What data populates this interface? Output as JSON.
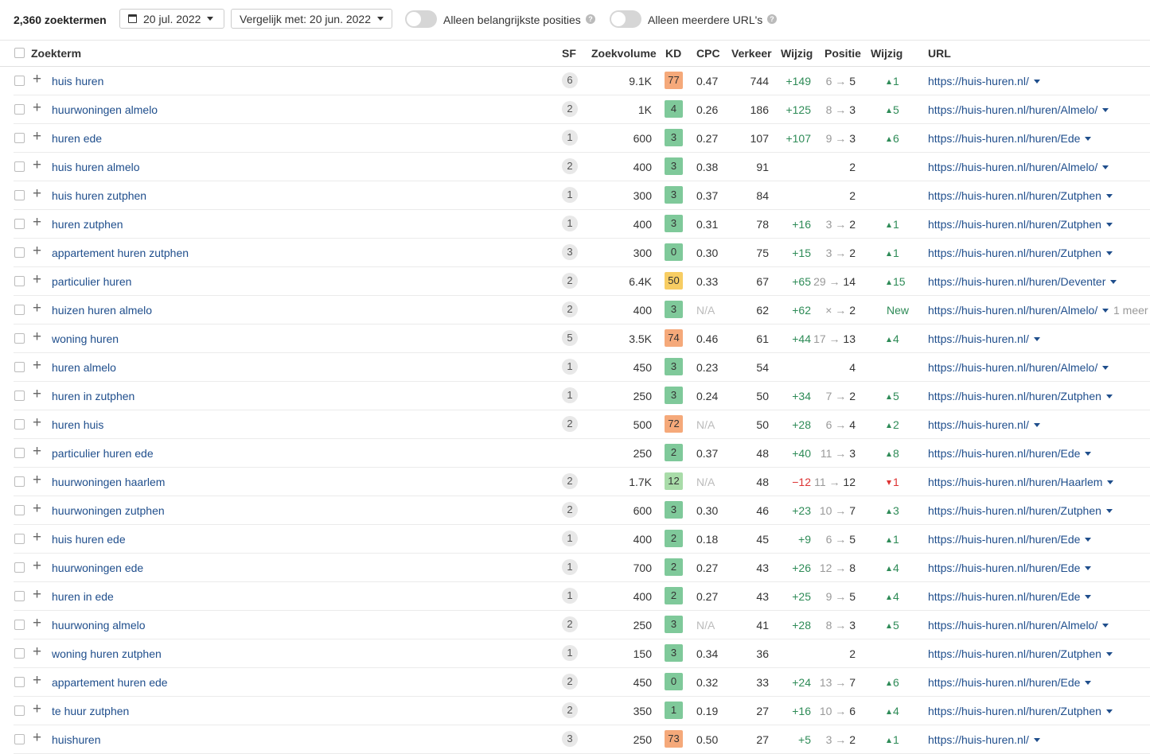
{
  "toolbar": {
    "count": "2,360 zoektermen",
    "date": "20 jul. 2022",
    "compare": "Vergelijk met: 20 jun. 2022",
    "toggle1": "Alleen belangrijkste posities",
    "toggle2": "Alleen meerdere URL's",
    "help": "?"
  },
  "headers": {
    "keyword": "Zoekterm",
    "sf": "SF",
    "volume": "Zoekvolume",
    "kd": "KD",
    "cpc": "CPC",
    "traffic": "Verkeer",
    "change": "Wijzig",
    "position": "Positie",
    "pos_change": "Wijzig",
    "url": "URL"
  },
  "colors": {
    "kd_green": "#7fc99a",
    "kd_lightgreen": "#a9dca9",
    "kd_yellow": "#f7cd63",
    "kd_orange": "#f5a97a",
    "link": "#1f4e8c",
    "up": "#2e8b57",
    "down": "#d33"
  },
  "rows": [
    {
      "kw": "huis huren",
      "sf": "6",
      "vol": "9.1K",
      "kd": "77",
      "cpc": "0.47",
      "traffic": "744",
      "chg": "+149",
      "from": "6",
      "to": "5",
      "pch": "1",
      "pdir": "up",
      "url": "https://huis-huren.nl/",
      "more": ""
    },
    {
      "kw": "huurwoningen almelo",
      "sf": "2",
      "vol": "1K",
      "kd": "4",
      "cpc": "0.26",
      "traffic": "186",
      "chg": "+125",
      "from": "8",
      "to": "3",
      "pch": "5",
      "pdir": "up",
      "url": "https://huis-huren.nl/huren/Almelo/",
      "more": ""
    },
    {
      "kw": "huren ede",
      "sf": "1",
      "vol": "600",
      "kd": "3",
      "cpc": "0.27",
      "traffic": "107",
      "chg": "+107",
      "from": "9",
      "to": "3",
      "pch": "6",
      "pdir": "up",
      "url": "https://huis-huren.nl/huren/Ede",
      "more": ""
    },
    {
      "kw": "huis huren almelo",
      "sf": "2",
      "vol": "400",
      "kd": "3",
      "cpc": "0.38",
      "traffic": "91",
      "chg": "",
      "from": "",
      "to": "2",
      "pch": "",
      "pdir": "",
      "url": "https://huis-huren.nl/huren/Almelo/",
      "more": ""
    },
    {
      "kw": "huis huren zutphen",
      "sf": "1",
      "vol": "300",
      "kd": "3",
      "cpc": "0.37",
      "traffic": "84",
      "chg": "",
      "from": "",
      "to": "2",
      "pch": "",
      "pdir": "",
      "url": "https://huis-huren.nl/huren/Zutphen",
      "more": ""
    },
    {
      "kw": "huren zutphen",
      "sf": "1",
      "vol": "400",
      "kd": "3",
      "cpc": "0.31",
      "traffic": "78",
      "chg": "+16",
      "from": "3",
      "to": "2",
      "pch": "1",
      "pdir": "up",
      "url": "https://huis-huren.nl/huren/Zutphen",
      "more": ""
    },
    {
      "kw": "appartement huren zutphen",
      "sf": "3",
      "vol": "300",
      "kd": "0",
      "cpc": "0.30",
      "traffic": "75",
      "chg": "+15",
      "from": "3",
      "to": "2",
      "pch": "1",
      "pdir": "up",
      "url": "https://huis-huren.nl/huren/Zutphen",
      "more": ""
    },
    {
      "kw": "particulier huren",
      "sf": "2",
      "vol": "6.4K",
      "kd": "50",
      "cpc": "0.33",
      "traffic": "67",
      "chg": "+65",
      "from": "29",
      "to": "14",
      "pch": "15",
      "pdir": "up",
      "url": "https://huis-huren.nl/huren/Deventer",
      "more": ""
    },
    {
      "kw": "huizen huren almelo",
      "sf": "2",
      "vol": "400",
      "kd": "3",
      "cpc": "N/A",
      "traffic": "62",
      "chg": "+62",
      "from": "×",
      "to": "2",
      "pch": "New",
      "pdir": "new",
      "url": "https://huis-huren.nl/huren/Almelo/",
      "more": "1 meer"
    },
    {
      "kw": "woning huren",
      "sf": "5",
      "vol": "3.5K",
      "kd": "74",
      "cpc": "0.46",
      "traffic": "61",
      "chg": "+44",
      "from": "17",
      "to": "13",
      "pch": "4",
      "pdir": "up",
      "url": "https://huis-huren.nl/",
      "more": ""
    },
    {
      "kw": "huren almelo",
      "sf": "1",
      "vol": "450",
      "kd": "3",
      "cpc": "0.23",
      "traffic": "54",
      "chg": "",
      "from": "",
      "to": "4",
      "pch": "",
      "pdir": "",
      "url": "https://huis-huren.nl/huren/Almelo/",
      "more": ""
    },
    {
      "kw": "huren in zutphen",
      "sf": "1",
      "vol": "250",
      "kd": "3",
      "cpc": "0.24",
      "traffic": "50",
      "chg": "+34",
      "from": "7",
      "to": "2",
      "pch": "5",
      "pdir": "up",
      "url": "https://huis-huren.nl/huren/Zutphen",
      "more": ""
    },
    {
      "kw": "huren huis",
      "sf": "2",
      "vol": "500",
      "kd": "72",
      "cpc": "N/A",
      "traffic": "50",
      "chg": "+28",
      "from": "6",
      "to": "4",
      "pch": "2",
      "pdir": "up",
      "url": "https://huis-huren.nl/",
      "more": ""
    },
    {
      "kw": "particulier huren ede",
      "sf": "",
      "vol": "250",
      "kd": "2",
      "cpc": "0.37",
      "traffic": "48",
      "chg": "+40",
      "from": "11",
      "to": "3",
      "pch": "8",
      "pdir": "up",
      "url": "https://huis-huren.nl/huren/Ede",
      "more": ""
    },
    {
      "kw": "huurwoningen haarlem",
      "sf": "2",
      "vol": "1.7K",
      "kd": "12",
      "cpc": "N/A",
      "traffic": "48",
      "chg": "−12",
      "from": "11",
      "to": "12",
      "pch": "1",
      "pdir": "down",
      "url": "https://huis-huren.nl/huren/Haarlem",
      "more": ""
    },
    {
      "kw": "huurwoningen zutphen",
      "sf": "2",
      "vol": "600",
      "kd": "3",
      "cpc": "0.30",
      "traffic": "46",
      "chg": "+23",
      "from": "10",
      "to": "7",
      "pch": "3",
      "pdir": "up",
      "url": "https://huis-huren.nl/huren/Zutphen",
      "more": ""
    },
    {
      "kw": "huis huren ede",
      "sf": "1",
      "vol": "400",
      "kd": "2",
      "cpc": "0.18",
      "traffic": "45",
      "chg": "+9",
      "from": "6",
      "to": "5",
      "pch": "1",
      "pdir": "up",
      "url": "https://huis-huren.nl/huren/Ede",
      "more": ""
    },
    {
      "kw": "huurwoningen ede",
      "sf": "1",
      "vol": "700",
      "kd": "2",
      "cpc": "0.27",
      "traffic": "43",
      "chg": "+26",
      "from": "12",
      "to": "8",
      "pch": "4",
      "pdir": "up",
      "url": "https://huis-huren.nl/huren/Ede",
      "more": ""
    },
    {
      "kw": "huren in ede",
      "sf": "1",
      "vol": "400",
      "kd": "2",
      "cpc": "0.27",
      "traffic": "43",
      "chg": "+25",
      "from": "9",
      "to": "5",
      "pch": "4",
      "pdir": "up",
      "url": "https://huis-huren.nl/huren/Ede",
      "more": ""
    },
    {
      "kw": "huurwoning almelo",
      "sf": "2",
      "vol": "250",
      "kd": "3",
      "cpc": "N/A",
      "traffic": "41",
      "chg": "+28",
      "from": "8",
      "to": "3",
      "pch": "5",
      "pdir": "up",
      "url": "https://huis-huren.nl/huren/Almelo/",
      "more": ""
    },
    {
      "kw": "woning huren zutphen",
      "sf": "1",
      "vol": "150",
      "kd": "3",
      "cpc": "0.34",
      "traffic": "36",
      "chg": "",
      "from": "",
      "to": "2",
      "pch": "",
      "pdir": "",
      "url": "https://huis-huren.nl/huren/Zutphen",
      "more": ""
    },
    {
      "kw": "appartement huren ede",
      "sf": "2",
      "vol": "450",
      "kd": "0",
      "cpc": "0.32",
      "traffic": "33",
      "chg": "+24",
      "from": "13",
      "to": "7",
      "pch": "6",
      "pdir": "up",
      "url": "https://huis-huren.nl/huren/Ede",
      "more": ""
    },
    {
      "kw": "te huur zutphen",
      "sf": "2",
      "vol": "350",
      "kd": "1",
      "cpc": "0.19",
      "traffic": "27",
      "chg": "+16",
      "from": "10",
      "to": "6",
      "pch": "4",
      "pdir": "up",
      "url": "https://huis-huren.nl/huren/Zutphen",
      "more": ""
    },
    {
      "kw": "huishuren",
      "sf": "3",
      "vol": "250",
      "kd": "73",
      "cpc": "0.50",
      "traffic": "27",
      "chg": "+5",
      "from": "3",
      "to": "2",
      "pch": "1",
      "pdir": "up",
      "url": "https://huis-huren.nl/",
      "more": ""
    }
  ]
}
